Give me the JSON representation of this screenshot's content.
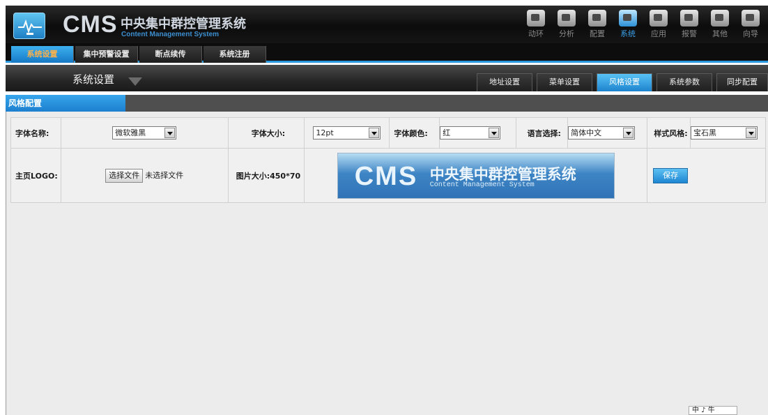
{
  "header": {
    "brand": "CMS",
    "brand_cn": "中央集中群控管理系统",
    "brand_en": "Content Management System",
    "nav": [
      {
        "label": "动环",
        "icon": "monitor-icon"
      },
      {
        "label": "分析",
        "icon": "user-chart-icon"
      },
      {
        "label": "配置",
        "icon": "config-icon"
      },
      {
        "label": "系统",
        "icon": "system-icon",
        "active": true
      },
      {
        "label": "应用",
        "icon": "app-icon"
      },
      {
        "label": "报警",
        "icon": "alarm-icon"
      },
      {
        "label": "其他",
        "icon": "other-icon"
      },
      {
        "label": "向导",
        "icon": "wizard-icon"
      }
    ]
  },
  "top_tabs": [
    "系统设置",
    "集中预警设置",
    "断点续传",
    "系统注册"
  ],
  "section": {
    "title": "系统设置",
    "tabs": [
      "地址设置",
      "菜单设置",
      "风格设置",
      "系统参数",
      "同步配置"
    ]
  },
  "panel": {
    "title": "风格配置"
  },
  "form": {
    "font_name_label": "字体名称:",
    "font_name_value": "微软雅黑",
    "font_size_label": "字体大小:",
    "font_size_value": "12pt",
    "font_color_label": "字体颜色:",
    "font_color_value": "红",
    "language_label": "语言选择:",
    "language_value": "简体中文",
    "style_label": "样式风格:",
    "style_value": "宝石黑",
    "logo_label": "主页LOGO:",
    "file_button": "选择文件",
    "file_status": "未选择文件",
    "image_size_label": "图片大小:450*70",
    "preview_brand": "CMS",
    "preview_cn": "中央集中群控管理系统",
    "preview_en": "Content Management System",
    "save_label": "保存"
  },
  "ime": "中 ♪ 牛",
  "colors": {
    "accent": "#1e86d2",
    "header_bg": "#111111",
    "content_bg": "#ececec"
  }
}
